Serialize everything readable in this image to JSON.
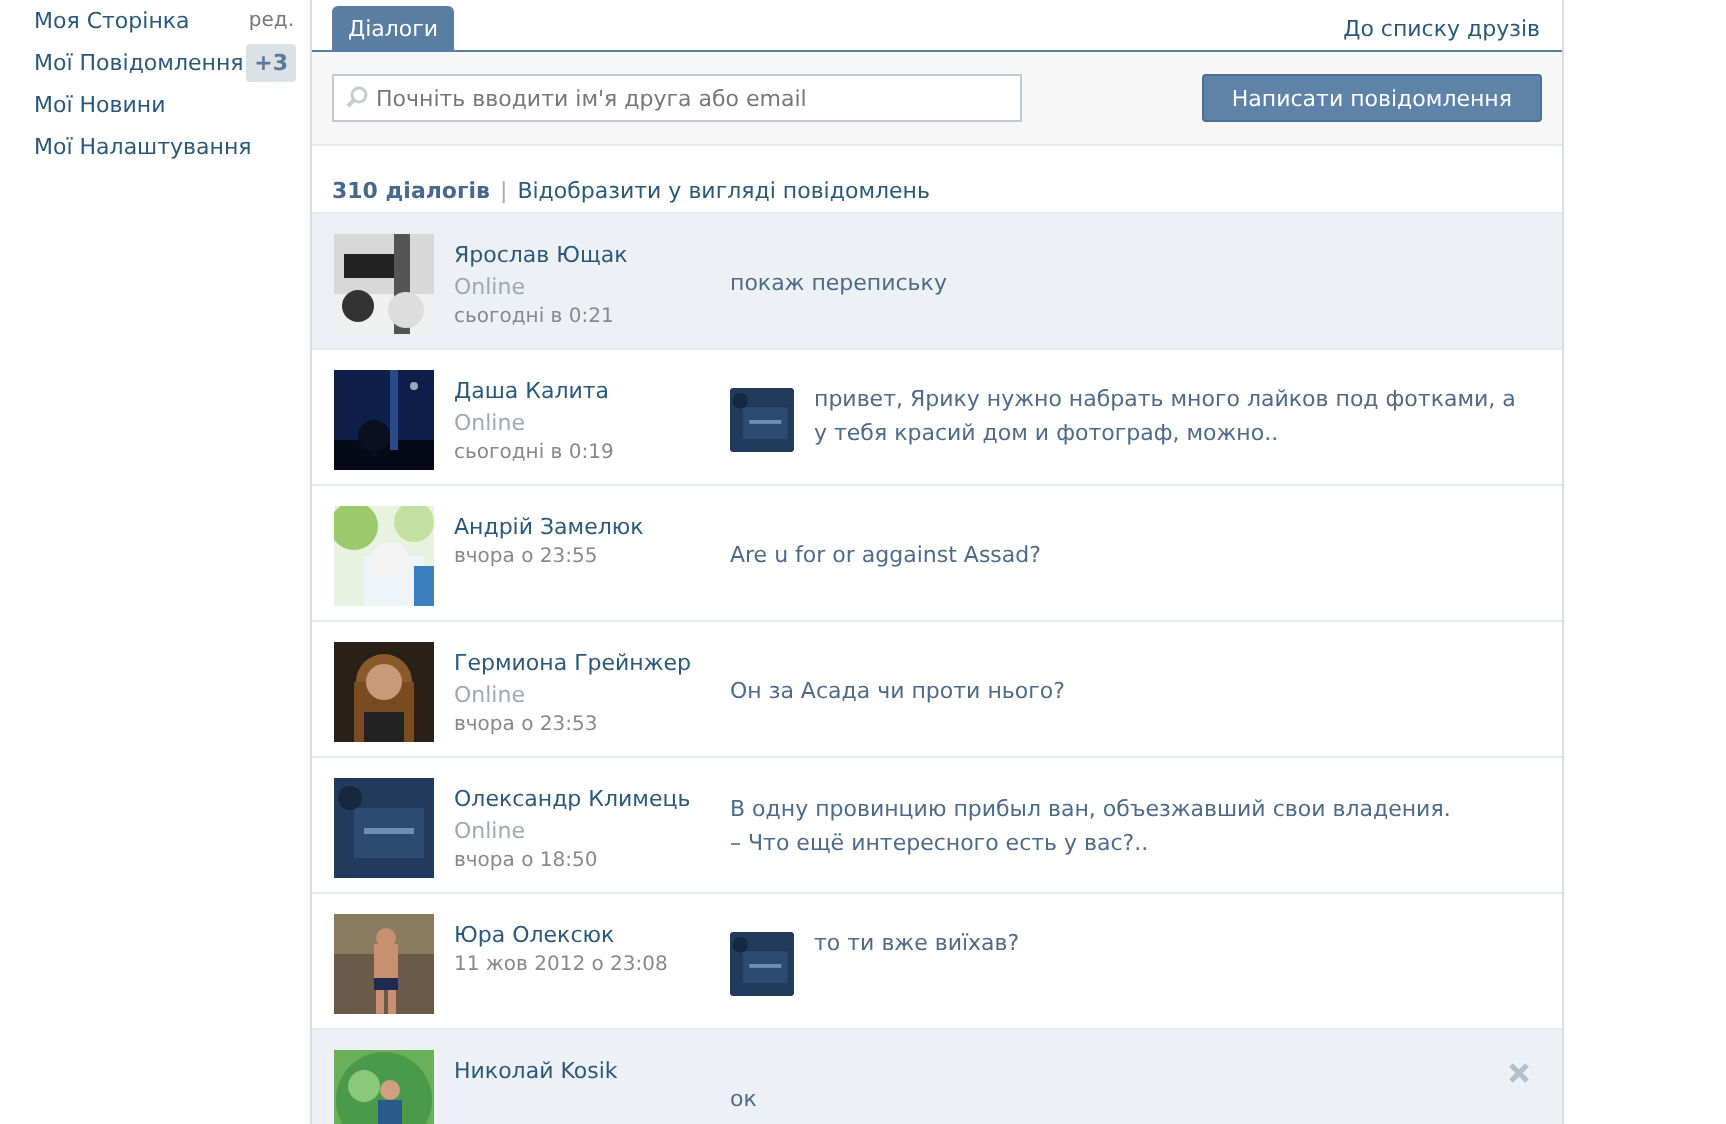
{
  "sidebar": {
    "items": [
      {
        "label": "Моя Сторінка",
        "edit": "ред."
      },
      {
        "label": "Мої Повідомлення",
        "badge": "+3"
      },
      {
        "label": "Мої Новини"
      },
      {
        "label": "Мої Налаштування"
      }
    ]
  },
  "tabs": [
    {
      "label": "Діалоги",
      "selected": true
    }
  ],
  "friends_link": "До списку друзів",
  "search": {
    "placeholder": "Почніть вводити ім'я друга або email"
  },
  "compose_button": "Написати повідомлення",
  "summary": {
    "count": "310 діалогів",
    "separator": "|",
    "view_link": "Відобразити у вигляді повідомлень"
  },
  "dialogs": [
    {
      "name": "Ярослав Ющак",
      "status": "Online",
      "time": "сьогодні в 0:21",
      "message": "покаж перепиську",
      "own_reply": false,
      "highlighted": true,
      "show_delete": false
    },
    {
      "name": "Даша Калита",
      "status": "Online",
      "time": "сьогодні в 0:19",
      "message": "привет, Ярику нужно набрать много лайков под фотками, а у тебя красий дом и фотограф, можно..",
      "own_reply": true,
      "highlighted": false,
      "show_delete": false
    },
    {
      "name": "Андрій Замелюк",
      "time": "вчора о 23:55",
      "message": "Are u for or aggainst Assad?",
      "own_reply": false,
      "highlighted": false,
      "show_delete": false
    },
    {
      "name": "Гермиона Грейнжер",
      "status": "Online",
      "time": "вчора о 23:53",
      "message": "Он за Асада чи проти нього?",
      "own_reply": false,
      "highlighted": false,
      "show_delete": false
    },
    {
      "name": "Олександр Климець",
      "status": "Online",
      "time": "вчора о 18:50",
      "message": "В одну провинцию прибыл ван, объезжавший свои владения.\n– Что ещё интересного есть у вас?..",
      "own_reply": false,
      "highlighted": false,
      "show_delete": false
    },
    {
      "name": "Юра Олексюк",
      "time": "11 жов 2012 о 23:08",
      "message": "то ти вже виїхав?",
      "own_reply": true,
      "highlighted": false,
      "show_delete": false
    },
    {
      "name": "Николай Kosik",
      "message": "ок",
      "own_reply": false,
      "highlighted": true,
      "show_delete": true
    }
  ]
}
